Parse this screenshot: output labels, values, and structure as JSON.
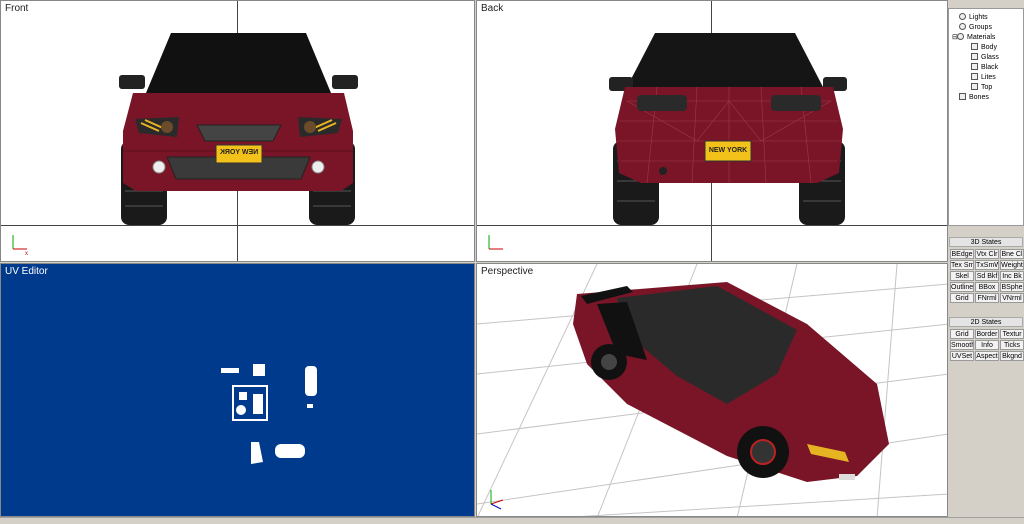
{
  "viewports": {
    "front": {
      "title": "Front"
    },
    "back": {
      "title": "Back"
    },
    "uv": {
      "title": "UV Editor"
    },
    "perspective": {
      "title": "Perspective"
    }
  },
  "plates": {
    "front": "NEW YORK",
    "back": "NEW YORK"
  },
  "scene_tree": [
    {
      "label": "Lights",
      "icon": "light-icon"
    },
    {
      "label": "Groups",
      "icon": "group-icon"
    },
    {
      "label": "Materials",
      "icon": "material-icon"
    },
    {
      "label": "Body",
      "icon": "material-swatch-icon"
    },
    {
      "label": "Glass",
      "icon": "material-swatch-icon"
    },
    {
      "label": "Black",
      "icon": "material-swatch-icon"
    },
    {
      "label": "Lites",
      "icon": "material-swatch-icon"
    },
    {
      "label": "Top",
      "icon": "material-swatch-icon"
    },
    {
      "label": "Bones",
      "icon": "bone-icon"
    }
  ],
  "states3d": {
    "title": "3D States",
    "buttons": [
      "BEdge",
      "Vtx Clr",
      "Bne Cl",
      "Tex Sm",
      "TxSmWr",
      "Weight",
      "Skel",
      "Sd Bkf",
      "Inc Bk",
      "Outline",
      "BBox",
      "BSphe",
      "Grid",
      "FNrml",
      "VNrml"
    ]
  },
  "states2d": {
    "title": "2D States",
    "buttons": [
      "Grid",
      "Border",
      "Textur",
      "Smooth",
      "Info",
      "Ticks",
      "UVSet",
      "Aspect",
      "Bkgnd"
    ]
  },
  "colors": {
    "car_body": "#7a1528",
    "uv_bg": "#003a8c",
    "grid": "#bdbdbd",
    "plate": "#f2c21b"
  }
}
